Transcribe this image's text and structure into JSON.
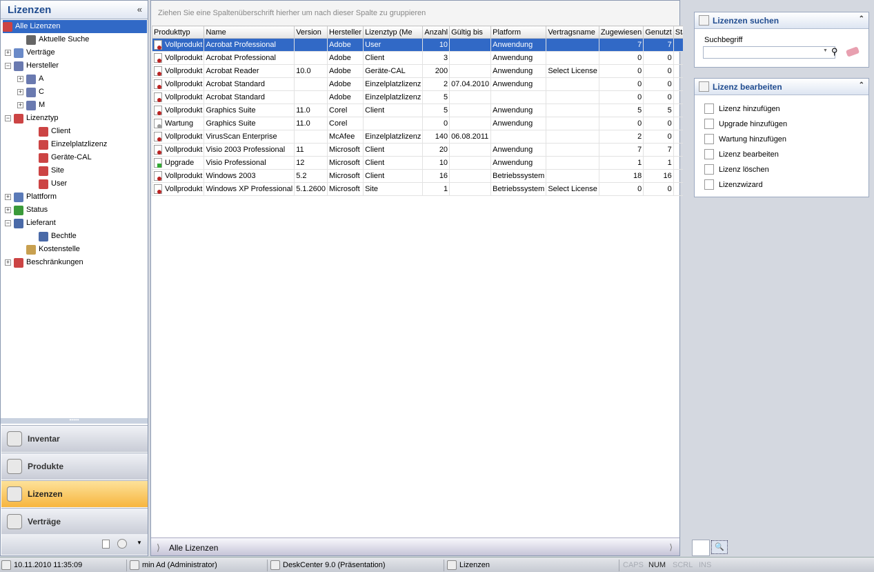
{
  "left": {
    "title": "Lizenzen",
    "collapse": "«",
    "tree": [
      {
        "label": "Alle Lizenzen",
        "level": 0,
        "exp": "",
        "sel": true
      },
      {
        "label": "Aktuelle Suche",
        "level": 1,
        "exp": ""
      },
      {
        "label": "Verträge",
        "level": 0,
        "exp": "+"
      },
      {
        "label": "Hersteller",
        "level": 0,
        "exp": "−"
      },
      {
        "label": "A",
        "level": 1,
        "exp": "+"
      },
      {
        "label": "C",
        "level": 1,
        "exp": "+"
      },
      {
        "label": "M",
        "level": 1,
        "exp": "+"
      },
      {
        "label": "Lizenztyp",
        "level": 0,
        "exp": "−"
      },
      {
        "label": "Client",
        "level": 2,
        "exp": ""
      },
      {
        "label": "Einzelplatzlizenz",
        "level": 2,
        "exp": ""
      },
      {
        "label": "Geräte-CAL",
        "level": 2,
        "exp": ""
      },
      {
        "label": "Site",
        "level": 2,
        "exp": ""
      },
      {
        "label": "User",
        "level": 2,
        "exp": ""
      },
      {
        "label": "Plattform",
        "level": 0,
        "exp": "+"
      },
      {
        "label": "Status",
        "level": 0,
        "exp": "+"
      },
      {
        "label": "Lieferant",
        "level": 0,
        "exp": "−"
      },
      {
        "label": "Bechtle",
        "level": 2,
        "exp": ""
      },
      {
        "label": "Kostenstelle",
        "level": 1,
        "exp": ""
      },
      {
        "label": "Beschränkungen",
        "level": 0,
        "exp": "+"
      }
    ],
    "nav": [
      {
        "label": "Inventar"
      },
      {
        "label": "Produkte"
      },
      {
        "label": "Lizenzen",
        "active": true
      },
      {
        "label": "Verträge"
      }
    ]
  },
  "grid": {
    "group_hint": "Ziehen Sie eine Spaltenüberschrift hierher um nach dieser Spalte zu gruppieren",
    "columns": [
      "Produkttyp",
      "Name",
      "Version",
      "Hersteller",
      "Lizenztyp (Me",
      "Anzahl",
      "Gültig bis",
      "Platform",
      "Vertragsname",
      "Zugewiesen",
      "Genutzt",
      "Status"
    ],
    "rows": [
      [
        "Vollprodukt",
        "Acrobat Professional",
        "",
        "Adobe",
        "User",
        "10",
        "",
        "Anwendung",
        "",
        "7",
        "7",
        "#3cb31c"
      ],
      [
        "Vollprodukt",
        "Acrobat Professional",
        "",
        "Adobe",
        "Client",
        "3",
        "",
        "Anwendung",
        "",
        "0",
        "0",
        "#8a949e"
      ],
      [
        "Vollprodukt",
        "Acrobat Reader",
        "10.0",
        "Adobe",
        "Geräte-CAL",
        "200",
        "",
        "Anwendung",
        "Select License",
        "0",
        "0",
        "#e0c418"
      ],
      [
        "Vollprodukt",
        "Acrobat Standard",
        "",
        "Adobe",
        "Einzelplatzlizenz",
        "2",
        "07.04.2010",
        "Anwendung",
        "",
        "0",
        "0",
        "#2a78c8"
      ],
      [
        "Vollprodukt",
        "Acrobat Standard",
        "",
        "Adobe",
        "Einzelplatzlizenz",
        "5",
        "",
        "",
        "",
        "0",
        "0",
        "#e0c418"
      ],
      [
        "Vollprodukt",
        "Graphics Suite",
        "11.0",
        "Corel",
        "Client",
        "5",
        "",
        "Anwendung",
        "",
        "5",
        "5",
        "#3cb31c"
      ],
      [
        "Wartung",
        "Graphics Suite",
        "11.0",
        "Corel",
        "",
        "0",
        "",
        "Anwendung",
        "",
        "0",
        "0",
        "#3cb31c"
      ],
      [
        "Vollprodukt",
        "VirusScan Enterprise",
        "",
        "McAfee",
        "Einzelplatzlizenz",
        "140",
        "06.08.2011",
        "",
        "",
        "2",
        "0",
        "#e0c418"
      ],
      [
        "Vollprodukt",
        "Visio 2003 Professional",
        "11",
        "Microsoft",
        "Client",
        "20",
        "",
        "Anwendung",
        "",
        "7",
        "7",
        "#3cb31c"
      ],
      [
        "Upgrade",
        "Visio Professional",
        "12",
        "Microsoft",
        "Client",
        "10",
        "",
        "Anwendung",
        "",
        "1",
        "1",
        "#3cb31c"
      ],
      [
        "Vollprodukt",
        "Windows 2003",
        "5.2",
        "Microsoft",
        "Client",
        "16",
        "",
        "Betriebssystem",
        "",
        "18",
        "16",
        "#d42020"
      ],
      [
        "Vollprodukt",
        "Windows XP Professional",
        "5.1.2600",
        "Microsoft",
        "Site",
        "1",
        "",
        "Betriebssystem",
        "Select License",
        "0",
        "0",
        "#2a78c8"
      ]
    ],
    "footer": "Alle Lizenzen"
  },
  "right": {
    "search": {
      "title": "Lizenzen suchen",
      "label": "Suchbegriff",
      "value": ""
    },
    "edit": {
      "title": "Lizenz bearbeiten",
      "tasks": [
        "Lizenz hinzufügen",
        "Upgrade hinzufügen",
        "Wartung hinzufügen",
        "Lizenz bearbeiten",
        "Lizenz löschen",
        "Lizenzwizard"
      ]
    }
  },
  "status": {
    "datetime": "10.11.2010 11:35:09",
    "user": "min Ad (Administrator)",
    "db": "DeskCenter 9.0 (Präsentation)",
    "module": "Lizenzen",
    "caps": "CAPS",
    "num": "NUM",
    "scrl": "SCRL",
    "ins": "INS"
  }
}
